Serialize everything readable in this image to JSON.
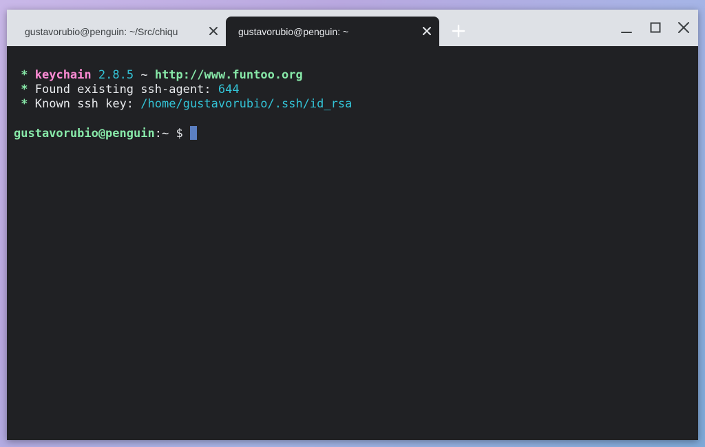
{
  "tabs": [
    {
      "title": "gustavorubio@penguin: ~/Src/chiqu",
      "active": false
    },
    {
      "title": "gustavorubio@penguin: ~",
      "active": true
    }
  ],
  "icons": {
    "tab_close": "close-icon",
    "new_tab": "plus-icon",
    "minimize": "minimize-icon",
    "maximize": "maximize-icon",
    "close_window": "close-icon"
  },
  "terminal": {
    "line1": {
      "star": "*",
      "name": "keychain",
      "version": "2.8.5",
      "sep": "~",
      "url": "http://www.funtoo.org"
    },
    "line2": {
      "star": "*",
      "text": "Found existing ssh-agent:",
      "value": "644"
    },
    "line3": {
      "star": "*",
      "text": "Known ssh key:",
      "value": "/home/gustavorubio/.ssh/id_rsa"
    },
    "prompt": {
      "user_host": "gustavorubio@penguin",
      "colon": ":",
      "path": "~",
      "symbol": "$"
    }
  },
  "colors": {
    "terminal_bg": "#202124",
    "titlebar_bg": "#dee1e6",
    "green": "#87e8a8",
    "pink": "#ff8cd6",
    "cyan": "#33c3d6",
    "cursor": "#5b7fc1"
  }
}
